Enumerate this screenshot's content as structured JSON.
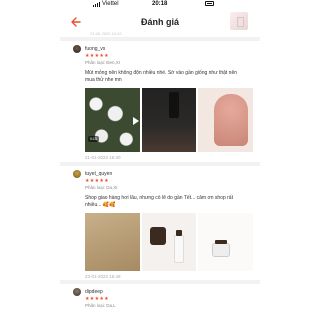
{
  "status_bar": {
    "carrier": "Viettel",
    "time": "20:18"
  },
  "header": {
    "title": "Đánh giá",
    "ghost_date": "21-06-2020 10:42"
  },
  "reviews": [
    {
      "username": "fuong_vs",
      "stars": "★★★★★",
      "variant": "Phân loại: Đen,XI",
      "text": "Mút mỏng nên không độn nhiều nhé. Sờ vào gần giống như thật nên mua thử nhe mn",
      "video_duration": "0:15",
      "date": "21-01-2022 16:30"
    },
    {
      "username": "tuyet_quyen",
      "stars": "★★★★★",
      "variant": "Phân loại: Da,XI",
      "text": "Shop giao hàng hơi lâu, nhưng có lẽ do gần Tết... cảm ơn shop rất nhiều... 🥰🥰",
      "date": "23-01-2022 15:49"
    },
    {
      "username": "dipdeep",
      "stars": "★★★★★",
      "variant": "Phân loại: Da,L"
    }
  ],
  "colors": {
    "accent": "#ee4d2d"
  }
}
